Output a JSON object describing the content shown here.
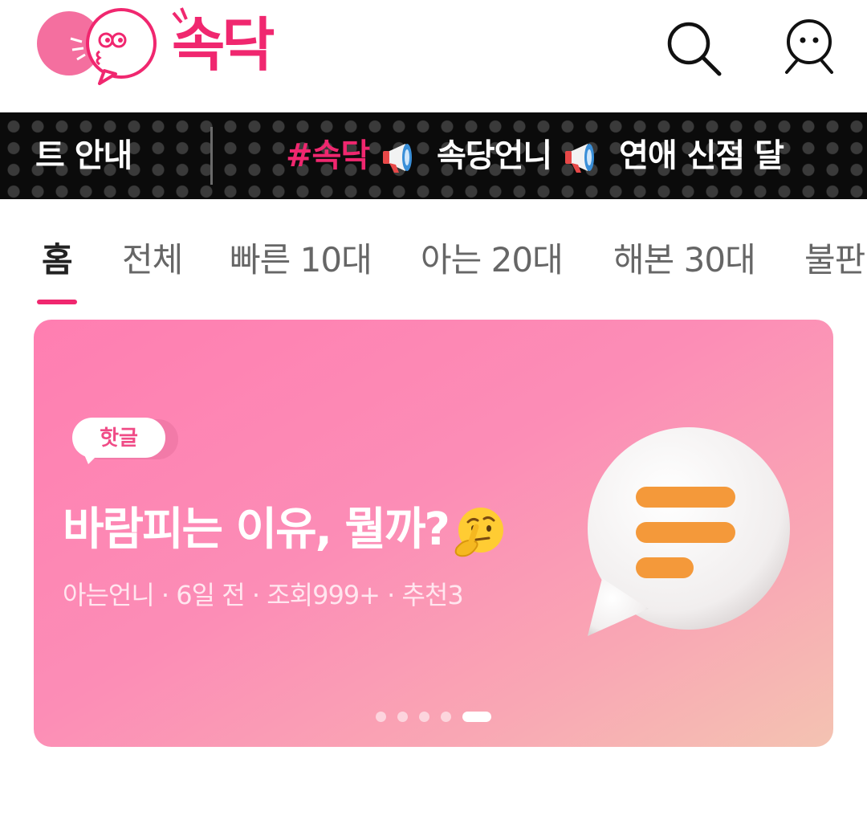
{
  "header": {
    "logo_text": "속닥"
  },
  "ticker": {
    "left_text": "트 안내",
    "hashtag": "#속닥",
    "mid_text": "속당언니",
    "end_text": "연애 신점 달"
  },
  "tabs": [
    {
      "label": "홈"
    },
    {
      "label": "전체"
    },
    {
      "label": "빠른 10대"
    },
    {
      "label": "아는 20대"
    },
    {
      "label": "해본 30대"
    },
    {
      "label": "불판"
    }
  ],
  "banner": {
    "badge": "핫글",
    "title": "바람피는 이유, 뭘까?",
    "meta": "아는언니 · 6일 전 · 조회999+ · 추천3",
    "slide_count": 5,
    "active_slide": 5
  },
  "colors": {
    "brand": "#f0276f",
    "ticker_bg": "#0b0b0b",
    "banner_start": "#ff7eb1",
    "banner_end": "#f4c3b2"
  },
  "icons": {
    "search": "search-icon",
    "profile": "profile-face-icon",
    "megaphone": "megaphone-icon",
    "thinking": "thinking-face-icon",
    "chat": "chat-bubble-icon"
  }
}
